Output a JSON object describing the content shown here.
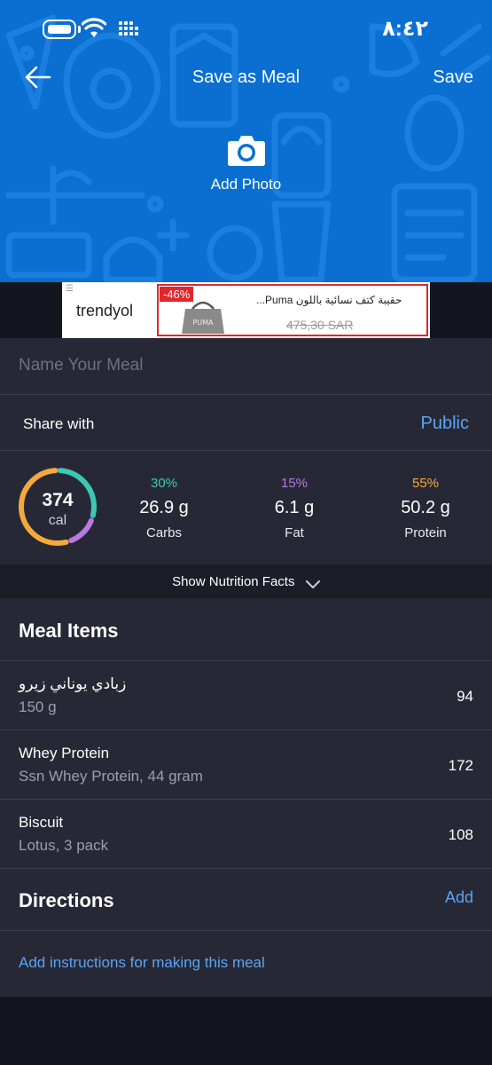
{
  "status_bar": {
    "time": "٨:٤٢"
  },
  "nav": {
    "title": "Save as Meal",
    "save_label": "Save"
  },
  "photo": {
    "label": "Add Photo"
  },
  "ad": {
    "brand": "trendyol",
    "discount": "-46%",
    "product_title": "حقيبة كتف نسائية باللون Puma...",
    "price": "475,30 SAR"
  },
  "meal_name": {
    "placeholder": "Name Your Meal",
    "value": ""
  },
  "share": {
    "label": "Share with",
    "value": "Public"
  },
  "nutrition": {
    "calories": "374",
    "calories_unit": "cal",
    "macros": [
      {
        "percent": "30%",
        "value": "26.9 g",
        "name": "Carbs",
        "color": "#3cc8b4"
      },
      {
        "percent": "15%",
        "value": "6.1 g",
        "name": "Fat",
        "color": "#b979e0"
      },
      {
        "percent": "55%",
        "value": "50.2 g",
        "name": "Protein",
        "color": "#f5a93a"
      }
    ]
  },
  "nutrition_toggle": {
    "label": "Show Nutrition Facts"
  },
  "meal_items": {
    "title": "Meal Items",
    "items": [
      {
        "name": "زبادي يوناني زيرو",
        "detail": "150 g",
        "calories": "94"
      },
      {
        "name": "Whey Protein",
        "detail": "Ssn Whey Protein, 44 gram",
        "calories": "172"
      },
      {
        "name": "Biscuit",
        "detail": "Lotus, 3 pack",
        "calories": "108"
      }
    ]
  },
  "directions": {
    "title": "Directions",
    "add_label": "Add",
    "placeholder_link": "Add instructions for making this meal"
  },
  "colors": {
    "header_blue": "#0a6fd0",
    "panel": "#262935",
    "background": "#14161f",
    "link_blue": "#5ba4f5"
  }
}
